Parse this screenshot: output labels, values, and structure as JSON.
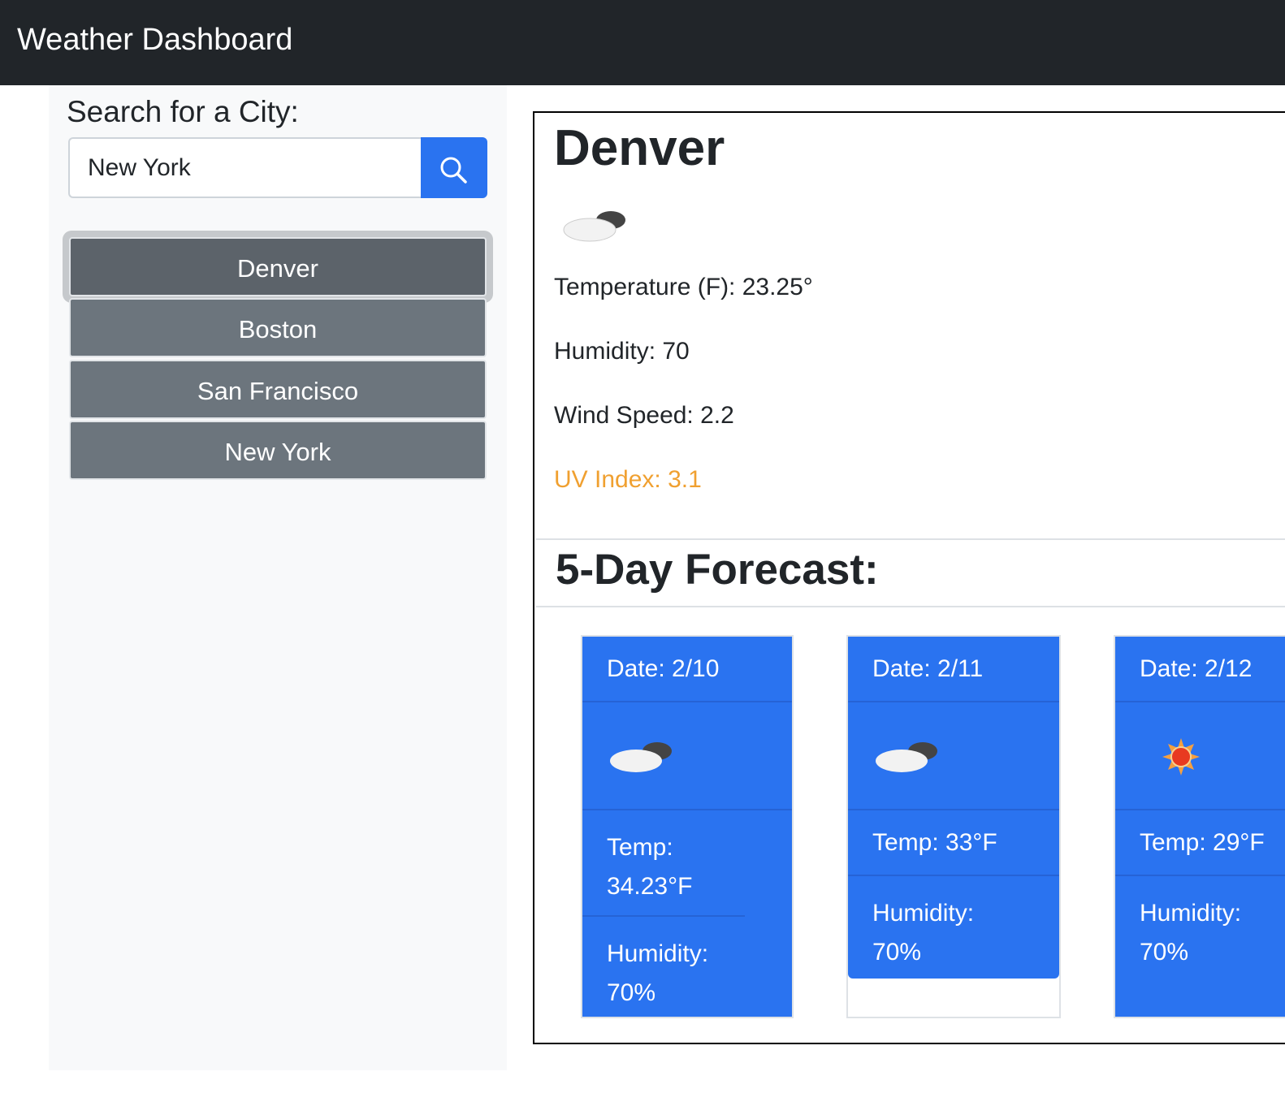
{
  "navbar": {
    "title": "Weather Dashboard"
  },
  "sidebar": {
    "heading": "Search for a City:",
    "search_value": "New York",
    "search_icon": "search-icon",
    "cities": [
      "Denver",
      "Boston",
      "San Francisco",
      "New York"
    ],
    "active_city": "Denver"
  },
  "current": {
    "city": "Denver",
    "icon": "cloudy-icon",
    "temperature": "Temperature (F): 23.25°",
    "humidity": "Humidity: 70",
    "wind": "Wind Speed: 2.2",
    "uv": "UV Index: 3.1",
    "uv_color": "#f0a030"
  },
  "forecast": {
    "heading": "5-Day Forecast:",
    "accent": "#2a73f0",
    "days": [
      {
        "date": "Date: 2/10",
        "icon": "cloudy-icon",
        "temp": "Temp: 34.23°F",
        "humidity": "Humidity: 70%"
      },
      {
        "date": "Date: 2/11",
        "icon": "cloudy-icon",
        "temp": "Temp: 33°F",
        "humidity": "Humidity: 70%"
      },
      {
        "date": "Date: 2/12",
        "icon": "sun-icon",
        "temp": "Temp: 29°F",
        "humidity": "Humidity: 70%"
      }
    ]
  }
}
